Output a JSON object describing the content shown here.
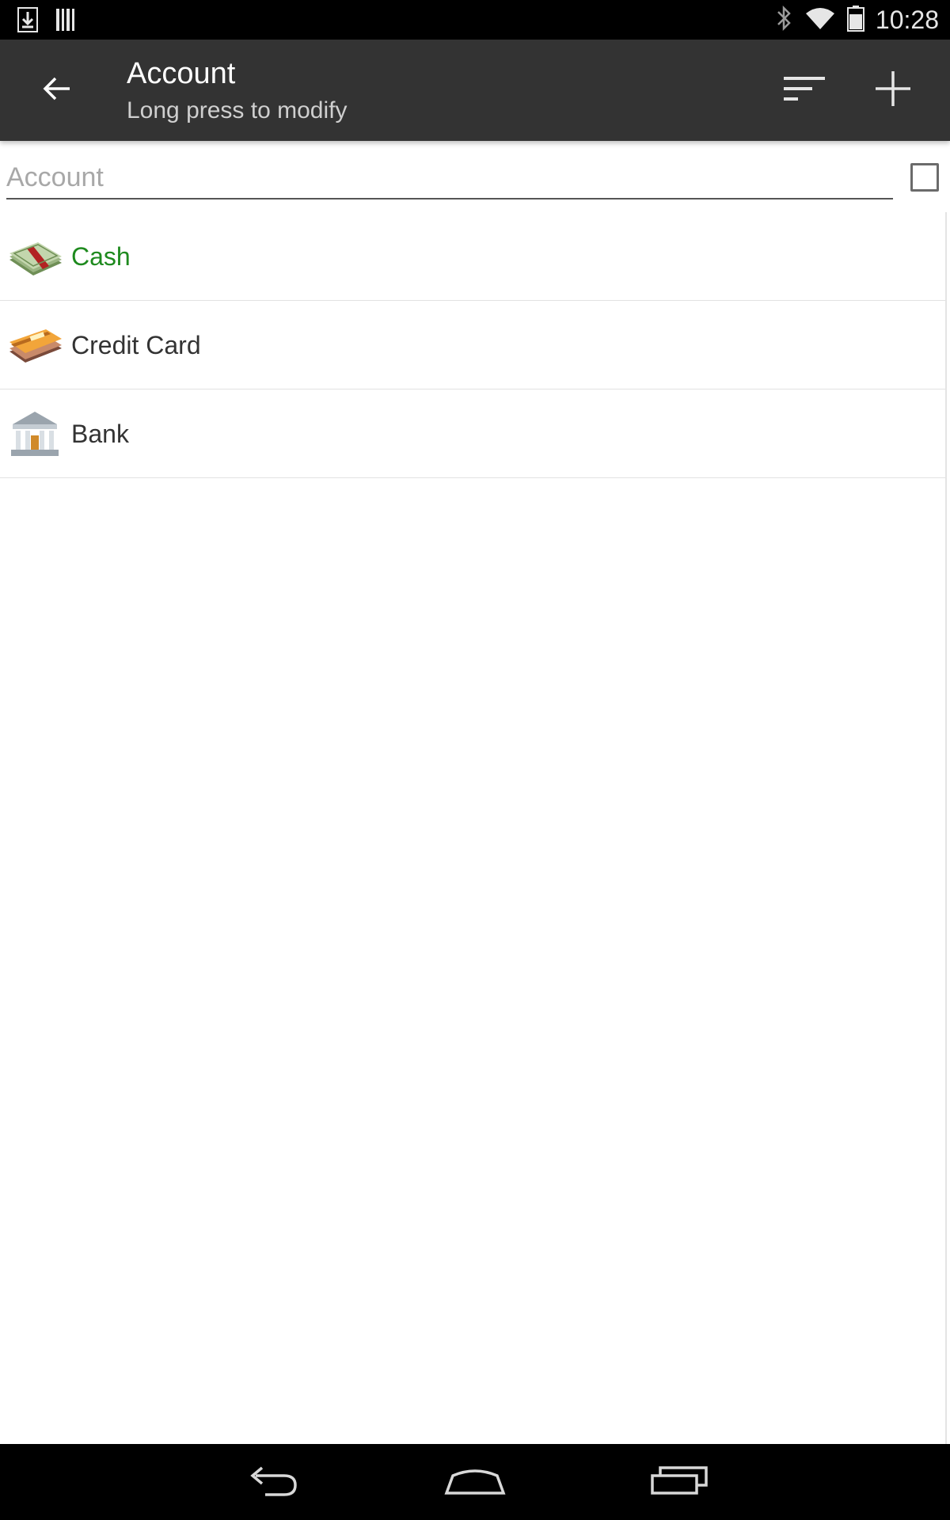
{
  "status_bar": {
    "time": "10:28",
    "icons": [
      "download-icon",
      "barcode-icon",
      "bluetooth-icon",
      "wifi-icon",
      "battery-icon"
    ]
  },
  "action_bar": {
    "title": "Account",
    "subtitle": "Long press to modify",
    "icons": [
      "back-arrow-icon",
      "sort-icon",
      "plus-icon"
    ]
  },
  "search": {
    "placeholder": "Account",
    "value": ""
  },
  "accounts": [
    {
      "label": "Cash",
      "icon": "cash-icon",
      "selected": true
    },
    {
      "label": "Credit Card",
      "icon": "credit-card-icon",
      "selected": false
    },
    {
      "label": "Bank",
      "icon": "bank-icon",
      "selected": false
    }
  ],
  "nav_bar": {
    "icons": [
      "back-nav-icon",
      "home-nav-icon",
      "recents-nav-icon"
    ]
  },
  "colors": {
    "action_bar_bg": "#333333",
    "selected_text": "#1e8a1e",
    "text": "#333333"
  }
}
